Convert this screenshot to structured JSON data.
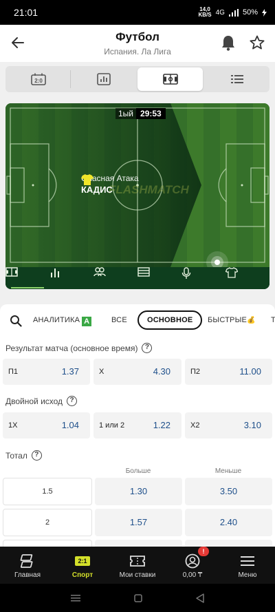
{
  "status": {
    "time": "21:01",
    "net_speed": "14,0",
    "net_unit": "KB/S",
    "net_type": "4G",
    "battery": "50%"
  },
  "header": {
    "title": "Футбол",
    "subtitle": "Испания. Ла Лига"
  },
  "view_tabs": [
    {
      "icon": "scoreboard-icon"
    },
    {
      "icon": "stats-chart-icon"
    },
    {
      "icon": "pitch-icon",
      "active": true
    },
    {
      "icon": "list-icon"
    }
  ],
  "match": {
    "half": "1ый",
    "clock": "29:53",
    "event_type": "Опасная Атака",
    "team": "КАДИС",
    "watermark": "FLASHMATCH"
  },
  "pitch_toolbar": [
    {
      "icon": "field-view-icon",
      "active": true
    },
    {
      "icon": "bar-stats-icon"
    },
    {
      "icon": "lineups-icon"
    },
    {
      "icon": "table-icon"
    },
    {
      "icon": "microphone-icon"
    },
    {
      "icon": "jersey-icon"
    }
  ],
  "filters": {
    "analytics": "АНАЛИТИКА",
    "analytics_badge": "A",
    "all": "ВСЕ",
    "main": "ОСНОВНОЕ",
    "fast": "БЫСТРЫЕ",
    "next": "Т"
  },
  "markets": {
    "result": {
      "title": "Результат матча (основное время)",
      "odds": [
        {
          "label": "П1",
          "value": "1.37"
        },
        {
          "label": "Х",
          "value": "4.30"
        },
        {
          "label": "П2",
          "value": "11.00"
        }
      ]
    },
    "double": {
      "title": "Двойной исход",
      "odds": [
        {
          "label": "1Х",
          "value": "1.04"
        },
        {
          "label": "1 или 2",
          "value": "1.22"
        },
        {
          "label": "Х2",
          "value": "3.10"
        }
      ]
    },
    "total": {
      "title": "Тотал",
      "over_label": "Больше",
      "under_label": "Меньше",
      "rows": [
        {
          "line": "1.5",
          "over": "1.30",
          "under": "3.50"
        },
        {
          "line": "2",
          "over": "1.57",
          "under": "2.40"
        }
      ]
    }
  },
  "bottom_nav": {
    "home": "Главная",
    "sport": "Спорт",
    "sport_badge": "2:1",
    "bets": "Мои ставки",
    "balance": "0,00 ₸",
    "balance_badge": "!",
    "menu": "Меню"
  },
  "colors": {
    "accent": "#d4e02a",
    "odds_text": "#1e4f8a",
    "pitch_dark": "#0d3418",
    "analytics_badge": "#3aa845"
  }
}
